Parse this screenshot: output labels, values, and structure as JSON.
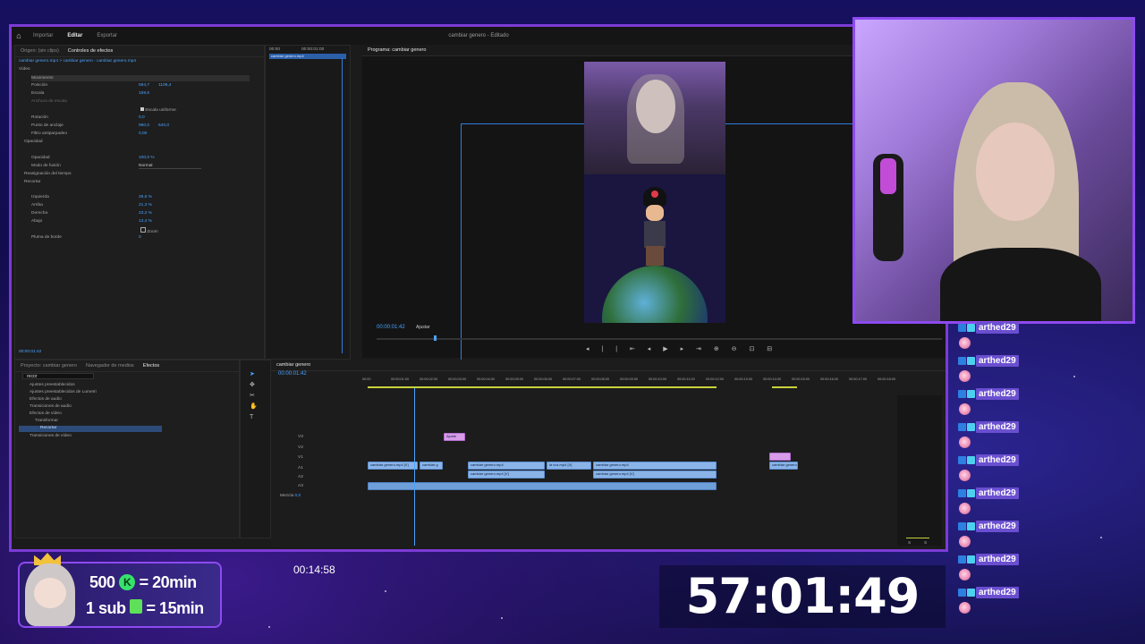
{
  "editor": {
    "tabs": [
      "Importar",
      "Editar",
      "Exportar"
    ],
    "active_tab": "Editar",
    "window_title": "cambiar genero - Editado",
    "source_tabs": [
      "Origen: (sin clips)",
      "Controles de efectos"
    ],
    "clip_path": "cambiar genero.mp4",
    "clip_path2": "cambiar genero - cambiar genero.mp4",
    "mini_clip": "cambiar genero.mp4",
    "effects": {
      "video_label": "Vídeo",
      "movement": "Movimiento",
      "position": "Posición",
      "position_x": "594,7",
      "position_y": "1109,4",
      "scale": "Escala",
      "scale_v": "159,6",
      "scale_width": "Anchura de escala",
      "uniform": "Escala uniforme",
      "rotation": "Rotación",
      "rotation_v": "0,0",
      "anchor": "Punto de anclaje",
      "anchor_x": "960,0",
      "anchor_y": "540,0",
      "flicker": "Filtro antiparpadeo",
      "flicker_v": "0,00",
      "opacity_label": "Opacidad",
      "opacity": "Opacidad",
      "opacity_v": "100,0 %",
      "blend": "Modo de fusión",
      "blend_v": "Normal",
      "remap": "Reasignación del tiempo",
      "crop_label": "Recortar",
      "izq": "Izquierda",
      "izq_v": "28,6 %",
      "arriba": "Arriba",
      "arriba_v": "21,3 %",
      "derecha": "Derecha",
      "derecha_v": "23,2 %",
      "abajo": "Abajo",
      "abajo_v": "13,4 %",
      "zoom": "Zoom",
      "pluma": "Pluma de borde",
      "pluma_v": "0"
    },
    "effects_time": "00:00:01:42",
    "mini_ruler": [
      "00:00",
      "00:00:01:00"
    ],
    "program_tab": "Programa: cambiar genero",
    "program_time": "00:00:01:42",
    "fit_label": "Ajustar",
    "project_tabs": [
      "Proyecto: cambiar genero",
      "Navegador de medios",
      "Efectos"
    ],
    "search_value": "recor",
    "bin_items": [
      "Ajustes preestablecidos",
      "Ajustes preestablecidos de Lumetri",
      "Efectos de audio",
      "Transiciones de audio",
      "Efectos de vídeo",
      "Transformar",
      "Recortar",
      "Transiciones de vídeo"
    ],
    "sequence_tab": "cambiar genero",
    "sequence_time": "00:00:01:42",
    "ruler": [
      "00:00",
      "00:00:01:00",
      "00:00:02:00",
      "00:00:03:00",
      "00:00:04:00",
      "00:00:05:00",
      "00:00:06:00",
      "00:00:07:00",
      "00:00:08:00",
      "00:00:09:00",
      "00:00:10:00",
      "00:00:11:00",
      "00:00:12:00",
      "00:00:13:00",
      "00:00:14:00",
      "00:00:15:00",
      "00:00:16:00",
      "00:00:17:00",
      "00:00:18:00"
    ],
    "tracks_v": [
      "V3",
      "V2",
      "V1"
    ],
    "tracks_a": [
      "A1",
      "A2",
      "A3"
    ],
    "mezcla": "Mezcla",
    "mezcla_v": "0,0",
    "clips": [
      "cambiar genero.mp4 [V]",
      "cambiar g",
      "cambiar genero.mp4",
      "la voz.mp4 [V]",
      "cambiar genero.mp4",
      "cambiar genero.mp4 [V]",
      "cambiar genero.mp4",
      "cambiar genero.mp4 [V]",
      "Ajuste"
    ],
    "meter_labels": [
      "S",
      "S"
    ]
  },
  "chat": {
    "user": "arthed29",
    "count": 9
  },
  "overlay": {
    "goal_line1_num": "500",
    "goal_line1_badge": "K",
    "goal_line1_rest": "= 20min",
    "goal_line2_num": "1 sub",
    "goal_line2_rest": "= 15min",
    "small_timer": "00:14:58",
    "big_timer": "57:01:49"
  },
  "colors": {
    "frame_border": "#7c3bd6",
    "webcam_border": "#8d4af0",
    "chat_name_bg": "#6a4fd0",
    "timeline_video_clip": "#8ab4e8",
    "accent_blue": "#4aa3ff"
  }
}
